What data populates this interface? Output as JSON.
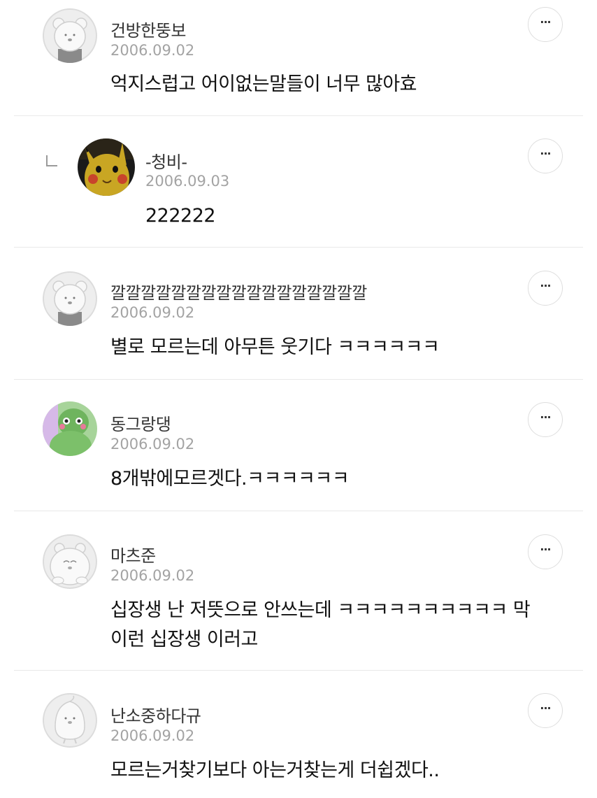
{
  "more_label": "···",
  "comments": [
    {
      "nickname": "건방한뚱보",
      "date": "2006.09.02",
      "text": "억지스럽고 어이없는말들이 너무 많아효",
      "avatar": "default-bear-avatar-icon"
    },
    {
      "nickname": "-청비-",
      "date": "2006.09.03",
      "text": "222222",
      "avatar": "pikachu-avatar-icon",
      "reply": true
    },
    {
      "nickname": "깔깔깔깔깔깔깔깔깔깔깔깔깔깔깔깔깔",
      "date": "2006.09.02",
      "text": "별로 모르는데 아무튼 웃기다 ㅋㅋㅋㅋㅋㅋ",
      "avatar": "default-bear-avatar-icon"
    },
    {
      "nickname": "동그랑댕",
      "date": "2006.09.02",
      "text": "8개밖에모르겟다.ㅋㅋㅋㅋㅋㅋ",
      "avatar": "green-character-avatar-icon"
    },
    {
      "nickname": "마츠준",
      "date": "2006.09.02",
      "text": "십장생 난 저뜻으로 안쓰는데 ㅋㅋㅋㅋㅋㅋㅋㅋㅋㅋ 막\n이런 십장생 이러고",
      "avatar": "default-hamster-avatar-icon"
    },
    {
      "nickname": "난소중하다규",
      "date": "2006.09.02",
      "text": "모르는거찾기보다 아는거찾는게 더쉽겠다..",
      "avatar": "default-penguin-avatar-icon"
    }
  ]
}
